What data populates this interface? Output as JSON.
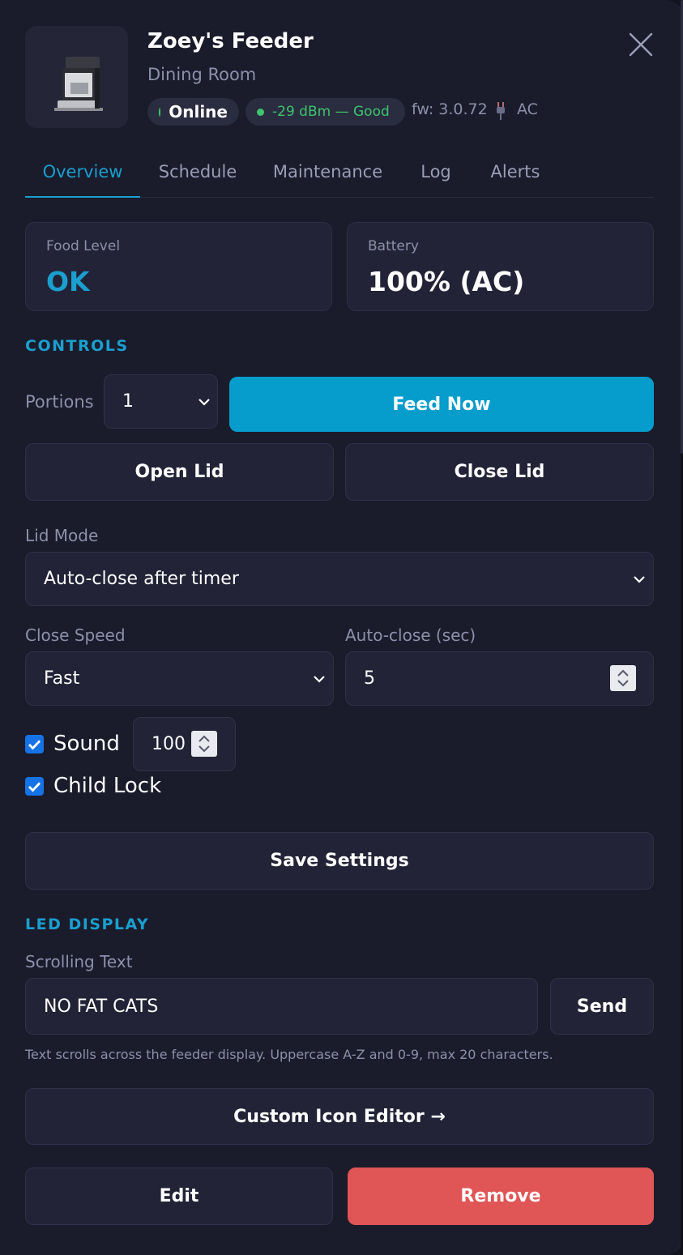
{
  "device": {
    "name": "Zoey's Feeder",
    "room": "Dining Room",
    "status": "Online",
    "signal": "-29 dBm — Good",
    "firmware": "fw: 3.0.72",
    "power": "AC",
    "image_icon": "feeder-device-image"
  },
  "tabs": [
    {
      "label": "Overview",
      "active": true
    },
    {
      "label": "Schedule",
      "active": false
    },
    {
      "label": "Maintenance",
      "active": false
    },
    {
      "label": "Log",
      "active": false
    },
    {
      "label": "Alerts",
      "active": false
    }
  ],
  "status_cards": {
    "food": {
      "label": "Food Level",
      "value": "OK"
    },
    "battery": {
      "label": "Battery",
      "value": "100% (AC)"
    }
  },
  "controls": {
    "section_title": "CONTROLS",
    "portions_label": "Portions",
    "portions_value": "1",
    "feed_now": "Feed Now",
    "open_lid": "Open Lid",
    "close_lid": "Close Lid",
    "lid_mode_label": "Lid Mode",
    "lid_mode_value": "Auto-close after timer",
    "close_speed_label": "Close Speed",
    "close_speed_value": "Fast",
    "auto_close_label": "Auto-close (sec)",
    "auto_close_value": "5",
    "sound_label": "Sound",
    "sound_checked": true,
    "sound_volume": "100",
    "child_lock_label": "Child Lock",
    "child_lock_checked": true,
    "save_settings": "Save Settings"
  },
  "led": {
    "section_title": "LED DISPLAY",
    "scrolling_label": "Scrolling Text",
    "scrolling_value": "NO FAT CATS",
    "send": "Send",
    "hint": "Text scrolls across the feeder display. Uppercase A-Z and 0-9, max 20 characters.",
    "custom_icon_editor": "Custom Icon Editor →"
  },
  "footer": {
    "edit": "Edit",
    "remove": "Remove"
  },
  "colors": {
    "accent": "#1a9fcf",
    "primary_button": "#069ccc",
    "danger": "#e05555",
    "online": "#3ec46d",
    "panel_bg": "#1a1b2b"
  }
}
